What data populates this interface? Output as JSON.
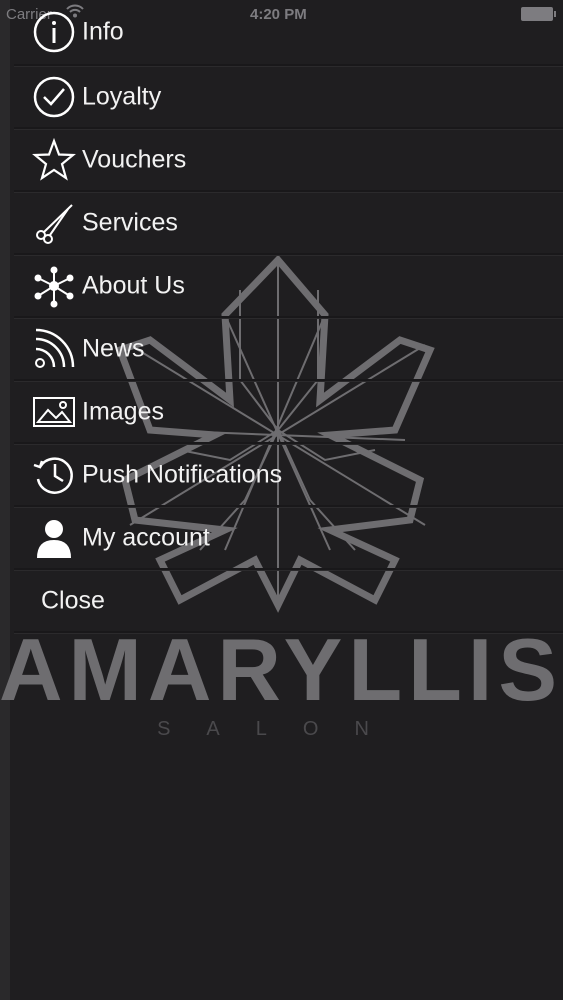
{
  "status_bar": {
    "carrier": "Carrier",
    "time": "4:20 PM"
  },
  "menu": {
    "items": [
      {
        "label": "Info",
        "icon": "info-icon"
      },
      {
        "label": "Loyalty",
        "icon": "checkmark-circle-icon"
      },
      {
        "label": "Vouchers",
        "icon": "star-icon"
      },
      {
        "label": "Services",
        "icon": "scissors-icon"
      },
      {
        "label": "About Us",
        "icon": "network-icon"
      },
      {
        "label": "News",
        "icon": "rss-icon"
      },
      {
        "label": "Images",
        "icon": "image-icon"
      },
      {
        "label": "Push Notifications",
        "icon": "history-clock-icon"
      },
      {
        "label": "My account",
        "icon": "user-icon"
      }
    ],
    "close_label": "Close"
  },
  "logo": {
    "wordmark": "AMARYLLIS",
    "tagline": "SALON"
  },
  "colors": {
    "background": "#1f1e20",
    "text": "#f2f2f2",
    "logo": "#8a898b"
  }
}
